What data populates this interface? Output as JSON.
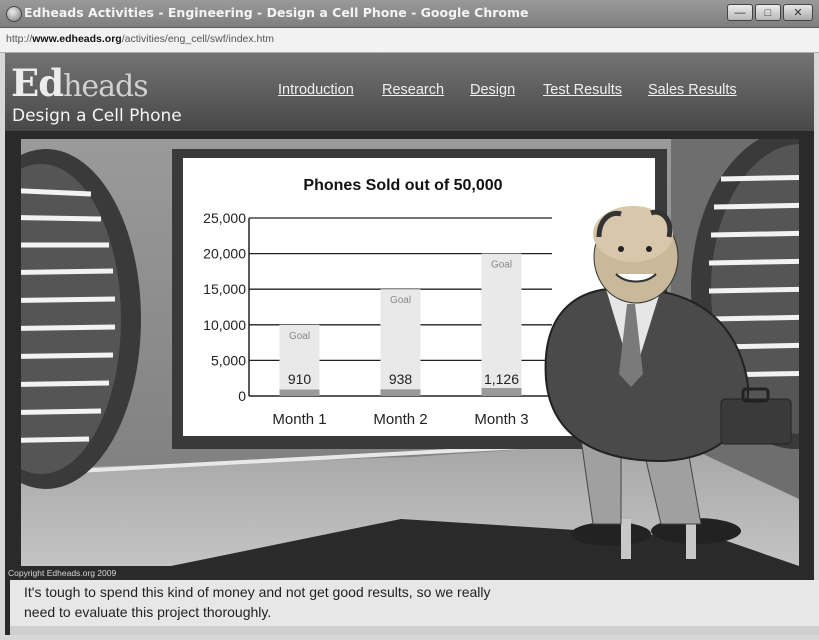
{
  "window": {
    "title": "Edheads Activities - Engineering - Design a Cell Phone - Google Chrome",
    "minimize_glyph": "—",
    "maximize_glyph": "□",
    "close_glyph": "✕"
  },
  "address": {
    "prefix": "http://",
    "domain": "www.edheads.org",
    "path": "/activities/eng_cell/swf/index.htm"
  },
  "header": {
    "logo_ed": "Ed",
    "logo_heads": "heads",
    "subtitle": "Design a Cell Phone",
    "nav": [
      "Introduction",
      "Research",
      "Design",
      "Test Results",
      "Sales Results"
    ]
  },
  "chart_data": {
    "type": "bar",
    "title": "Phones Sold out of 50,000",
    "categories": [
      "Month 1",
      "Month 2",
      "Month 3"
    ],
    "series": [
      {
        "name": "Goal",
        "values": [
          10000,
          15000,
          20000
        ]
      },
      {
        "values": [
          910,
          938,
          1126
        ]
      }
    ],
    "value_labels": [
      "910",
      "938",
      "1,126"
    ],
    "goal_label": "Goal",
    "yticks": [
      "0",
      "5,000",
      "10,000",
      "15,000",
      "20,000",
      "25,000"
    ],
    "ylim": [
      0,
      25000
    ],
    "grid": true
  },
  "copyright": "Copyright Edheads.org 2009",
  "caption": {
    "line1": "It's tough to spend this kind of money and not get good results, so we really",
    "line2": "need to evaluate this project thoroughly."
  }
}
